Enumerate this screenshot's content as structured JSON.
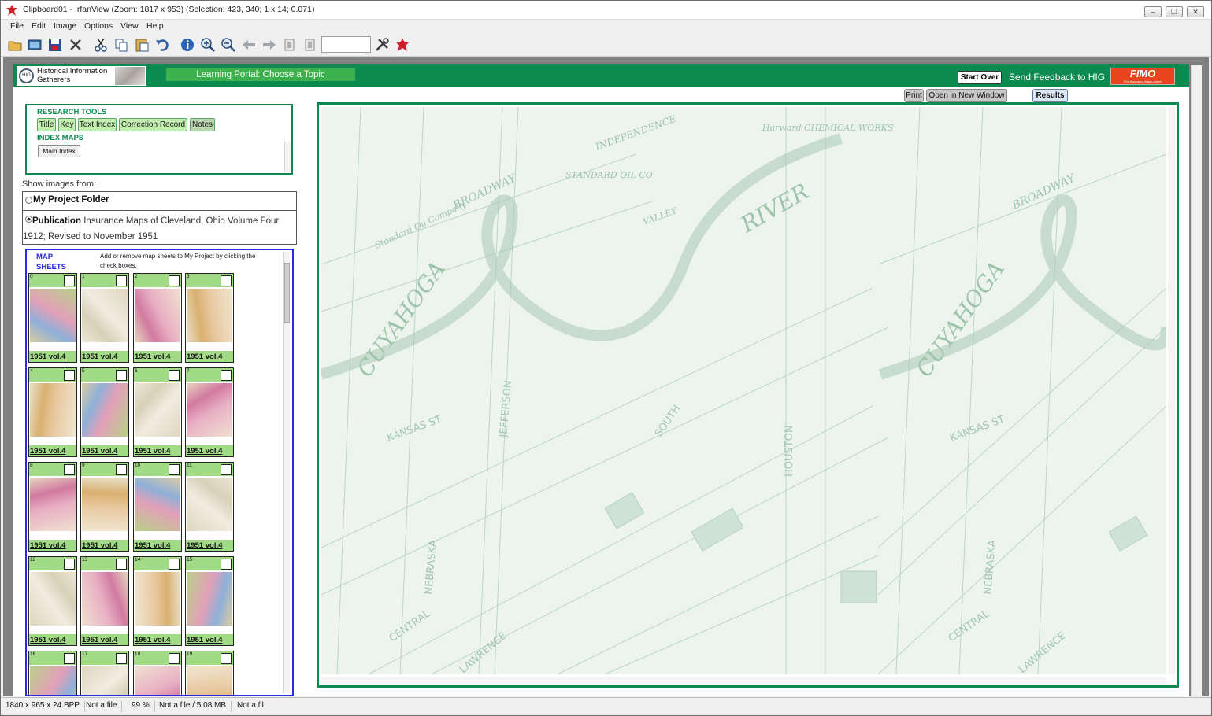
{
  "window": {
    "title": "Clipboard01 - IrfanView (Zoom: 1817 x 953) (Selection: 423, 340; 1 x 14; 0.071)",
    "controls": [
      "–",
      "❐",
      "✕"
    ]
  },
  "menu": [
    "File",
    "Edit",
    "Image",
    "Options",
    "View",
    "Help"
  ],
  "toolbar": {
    "icons": [
      "open-folder-icon",
      "slideshow-icon",
      "save-icon",
      "delete-icon",
      "cut-icon",
      "copy-icon",
      "paste-icon",
      "undo-icon",
      "info-icon",
      "zoom-in-icon",
      "zoom-out-icon",
      "previous-icon",
      "next-icon",
      "first-page-icon",
      "last-page-icon",
      "settings-icon",
      "exit-icon"
    ],
    "zoom_value": ""
  },
  "portal": {
    "logo_text": "Historical Information Gatherers",
    "logo_badge": "HIG",
    "tab_label": "Learning Portal: Choose a Topic",
    "start_over": "Start Over",
    "feedback": "Send Feedback to HIG",
    "fimo_main": "FIMO",
    "fimo_sub": "Fire Insurance Maps online",
    "buttons": {
      "print": "Print",
      "open_new": "Open in New Window",
      "results": "Results"
    },
    "research_tools_title": "RESEARCH TOOLS",
    "research_tools": [
      "Title",
      "Key",
      "Text Index",
      "Correction Record",
      "Notes"
    ],
    "index_maps_title": "INDEX MAPS",
    "main_index": "Main Index",
    "show_images_from": "Show images from:",
    "my_project_folder": "My Project Folder",
    "publication_label": "Publication",
    "publication_text": "Insurance Maps of Cleveland, Ohio Volume Four 1912; Revised to November 1951",
    "map_sheets_title": "MAP SHEETS",
    "map_sheets_hint": "Add or remove map sheets to My Project by clicking the check boxes.",
    "sheets": [
      {
        "num": "0",
        "label": "1951 vol.4"
      },
      {
        "num": "1",
        "label": "1951 vol.4"
      },
      {
        "num": "2",
        "label": "1951 vol.4"
      },
      {
        "num": "3",
        "label": "1951 vol.4"
      },
      {
        "num": "4",
        "label": "1951 vol.4"
      },
      {
        "num": "5",
        "label": "1951 vol.4"
      },
      {
        "num": "6",
        "label": "1951 vol.4"
      },
      {
        "num": "7",
        "label": "1951 vol.4"
      },
      {
        "num": "8",
        "label": "1951 vol.4"
      },
      {
        "num": "9",
        "label": "1951 vol.4"
      },
      {
        "num": "10",
        "label": "1951 vol.4"
      },
      {
        "num": "11",
        "label": "1951 vol.4"
      },
      {
        "num": "12",
        "label": "1951 vol.4"
      },
      {
        "num": "13",
        "label": "1951 vol.4"
      },
      {
        "num": "14",
        "label": "1951 vol.4"
      },
      {
        "num": "15",
        "label": "1951 vol.4"
      },
      {
        "num": "16",
        "label": ""
      },
      {
        "num": "17",
        "label": ""
      },
      {
        "num": "18",
        "label": ""
      },
      {
        "num": "19",
        "label": ""
      }
    ],
    "map_labels": {
      "river": "RIVER",
      "cuyahoga": "CUYAHOGA",
      "broadway": "BROADWAY",
      "kansas": "KANSAS ST",
      "nebraska": "NEBRASKA",
      "central": "CENTRAL",
      "lawrence": "LAWRENCE",
      "jefferson": "JEFFERSON",
      "houston": "HOUSTON",
      "south": "SOUTH",
      "independence": "INDEPENDENCE",
      "standard_oil": "STANDARD OIL CO",
      "standard_oil_company": "Standard Oil Company",
      "harward": "Harward CHEMICAL WORKS",
      "valley": "VALLEY"
    }
  },
  "status": [
    "1840 x 965 x 24 BPP",
    "Not a file",
    "99 %",
    "Not a file / 5.08 MB",
    "Not a fil"
  ]
}
